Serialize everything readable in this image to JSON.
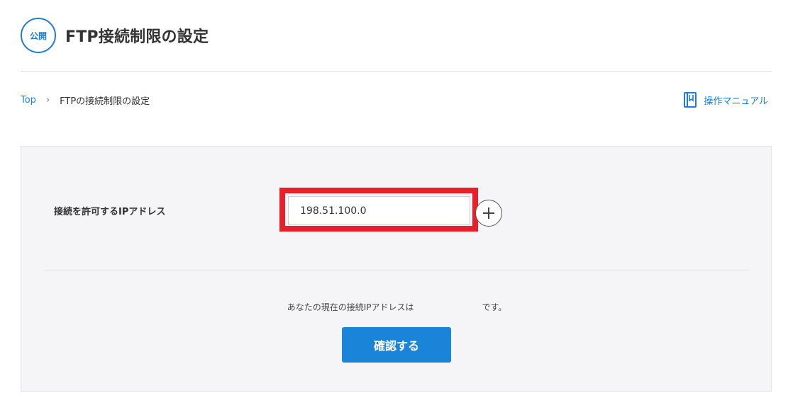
{
  "header": {
    "badge": "公開",
    "title": "FTP接続制限の設定"
  },
  "breadcrumb": {
    "top": "Top",
    "separator": "›",
    "current": "FTPの接続制限の設定"
  },
  "manual": {
    "label": "操作マニュアル",
    "icon": "book-icon"
  },
  "form": {
    "label": "接続を許可するIPアドレス",
    "ip_value": "198.51.100.0",
    "add_icon": "plus-icon",
    "current_ip_prefix": "あなたの現在の接続IPアドレスは",
    "current_ip_suffix": "です。",
    "submit_label": "確認する"
  },
  "colors": {
    "accent": "#1f7ed0",
    "button": "#1a84d8",
    "highlight": "#e8202a",
    "panel_bg": "#f5f5f8"
  }
}
